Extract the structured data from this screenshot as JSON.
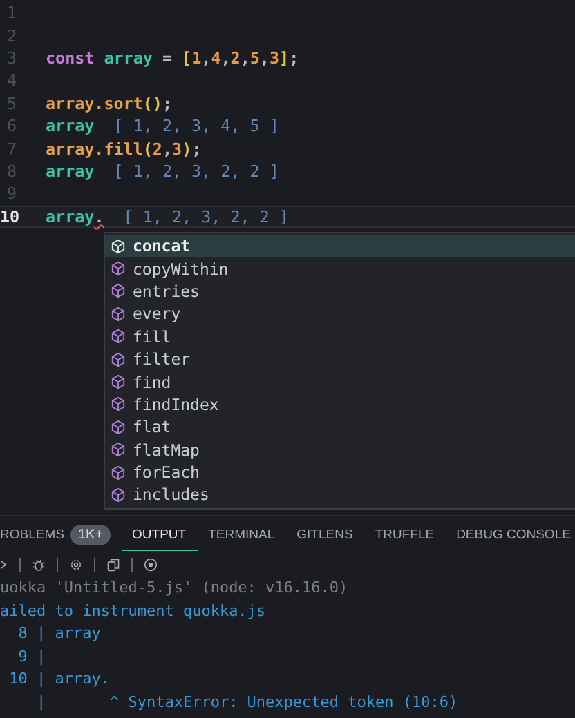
{
  "editor": {
    "lines": [
      {
        "number": "1",
        "current": false
      },
      {
        "number": "2",
        "current": false
      },
      {
        "number": "3",
        "current": false,
        "tokens": [
          {
            "kind": "keyword",
            "text": "const "
          },
          {
            "kind": "variable",
            "text": "array"
          },
          {
            "kind": "punct",
            "text": " = "
          },
          {
            "kind": "bracket",
            "text": "["
          },
          {
            "kind": "number",
            "text": "1"
          },
          {
            "kind": "punct",
            "text": ","
          },
          {
            "kind": "number",
            "text": "4"
          },
          {
            "kind": "punct",
            "text": ","
          },
          {
            "kind": "number",
            "text": "2"
          },
          {
            "kind": "punct",
            "text": ","
          },
          {
            "kind": "number",
            "text": "5"
          },
          {
            "kind": "punct",
            "text": ","
          },
          {
            "kind": "number",
            "text": "3"
          },
          {
            "kind": "bracket",
            "text": "]"
          },
          {
            "kind": "punct",
            "text": ";"
          }
        ]
      },
      {
        "number": "4",
        "current": false
      },
      {
        "number": "5",
        "current": false,
        "tokens": [
          {
            "kind": "call",
            "text": "array.sort"
          },
          {
            "kind": "bracket",
            "text": "()"
          },
          {
            "kind": "punct",
            "text": ";"
          }
        ]
      },
      {
        "number": "6",
        "current": false,
        "tokens": [
          {
            "kind": "variable",
            "text": "array"
          },
          {
            "kind": "result",
            "text": "  [ 1, 2, 3, 4, 5 ]"
          }
        ]
      },
      {
        "number": "7",
        "current": false,
        "tokens": [
          {
            "kind": "call",
            "text": "array.fill"
          },
          {
            "kind": "bracket",
            "text": "("
          },
          {
            "kind": "number",
            "text": "2"
          },
          {
            "kind": "punct",
            "text": ","
          },
          {
            "kind": "number",
            "text": "3"
          },
          {
            "kind": "bracket",
            "text": ")"
          },
          {
            "kind": "punct",
            "text": ";"
          }
        ]
      },
      {
        "number": "8",
        "current": false,
        "tokens": [
          {
            "kind": "variable",
            "text": "array"
          },
          {
            "kind": "result",
            "text": "  [ 1, 2, 3, 2, 2 ]"
          }
        ]
      },
      {
        "number": "9",
        "current": false
      },
      {
        "number": "10",
        "current": true,
        "tokens": [
          {
            "kind": "variable",
            "text": "array"
          },
          {
            "kind": "error",
            "text": "."
          },
          {
            "kind": "result",
            "text": "  [ 1, 2, 3, 2, 2 ]"
          }
        ]
      }
    ]
  },
  "suggestions": [
    {
      "label": "concat",
      "selected": true
    },
    {
      "label": "copyWithin",
      "selected": false
    },
    {
      "label": "entries",
      "selected": false
    },
    {
      "label": "every",
      "selected": false
    },
    {
      "label": "fill",
      "selected": false
    },
    {
      "label": "filter",
      "selected": false
    },
    {
      "label": "find",
      "selected": false
    },
    {
      "label": "findIndex",
      "selected": false
    },
    {
      "label": "flat",
      "selected": false
    },
    {
      "label": "flatMap",
      "selected": false
    },
    {
      "label": "forEach",
      "selected": false
    },
    {
      "label": "includes",
      "selected": false
    }
  ],
  "panel": {
    "tabs": [
      {
        "label": "ROBLEMS",
        "badge": "1K+",
        "selected": false
      },
      {
        "label": "OUTPUT",
        "selected": true
      },
      {
        "label": "TERMINAL",
        "selected": false
      },
      {
        "label": "GITLENS",
        "selected": false
      },
      {
        "label": "TRUFFLE",
        "selected": false
      },
      {
        "label": "DEBUG CONSOLE",
        "selected": false
      }
    ],
    "output": [
      {
        "kind": "info",
        "text": "uokka 'Untitled-5.js' (node: v16.16.0)"
      },
      {
        "kind": "error",
        "text": "ailed to instrument quokka.js"
      },
      {
        "kind": "error",
        "text": "  8 | array"
      },
      {
        "kind": "error",
        "text": "  9 |"
      },
      {
        "kind": "error",
        "text": " 10 | array."
      },
      {
        "kind": "error",
        "text": "    |       ^ SyntaxError: Unexpected token (10:6)"
      }
    ]
  }
}
